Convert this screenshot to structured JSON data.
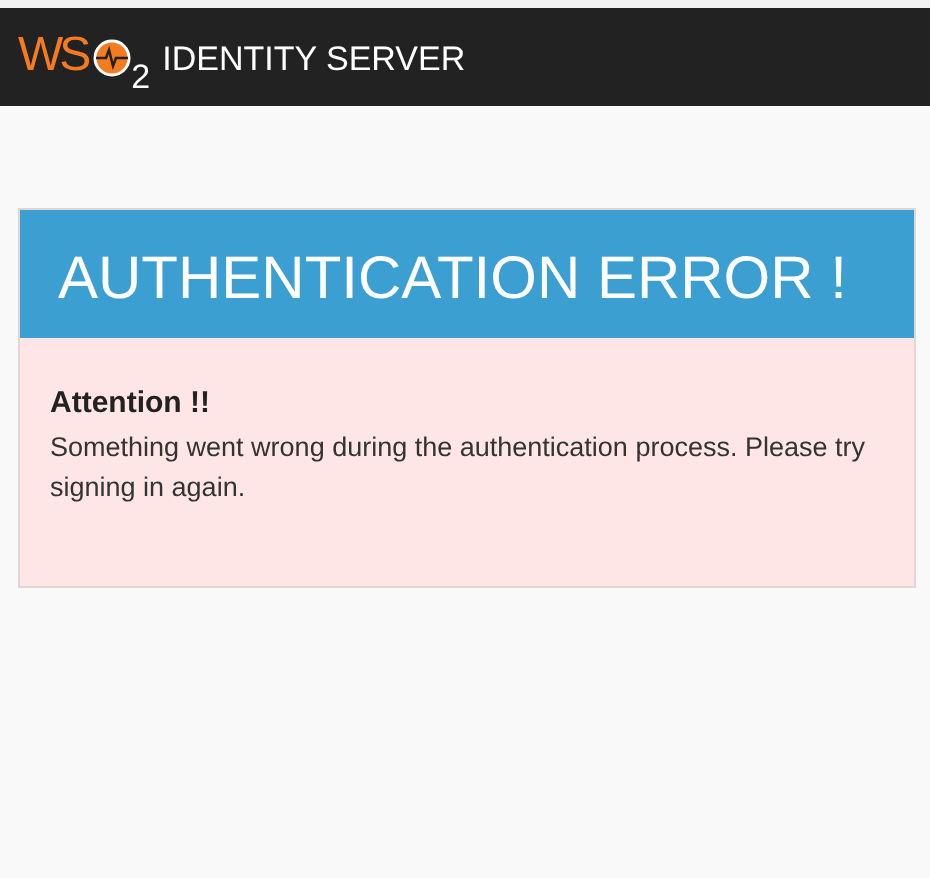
{
  "header": {
    "logo": {
      "letters": "WS",
      "subscript": "2"
    },
    "product": "IDENTITY SERVER"
  },
  "error": {
    "title": "AUTHENTICATION ERROR !",
    "heading": "Attention !!",
    "message": "Something went wrong during the authentication process. Please try signing in again."
  }
}
